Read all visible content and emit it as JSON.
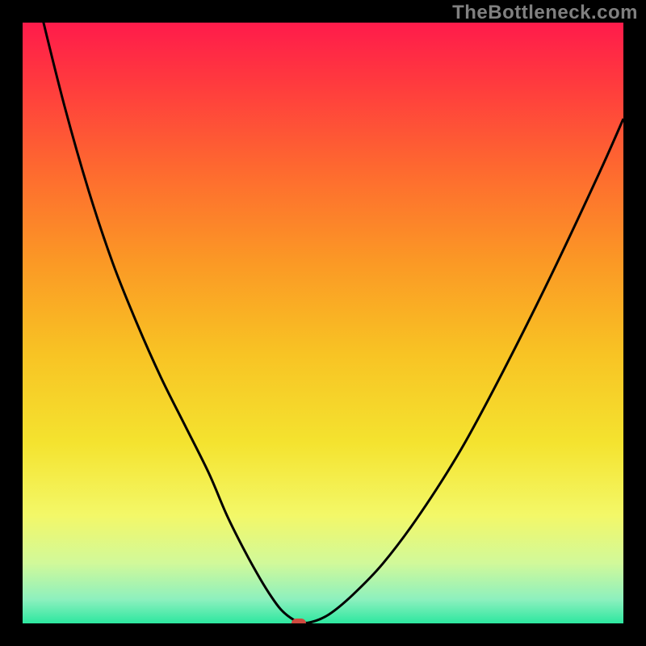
{
  "watermark": "TheBottleneck.com",
  "colors": {
    "frame": "#000000",
    "gradient_stops": [
      {
        "offset": 0.0,
        "color": "#ff1b4b"
      },
      {
        "offset": 0.1,
        "color": "#ff3a3e"
      },
      {
        "offset": 0.25,
        "color": "#fe6b2f"
      },
      {
        "offset": 0.4,
        "color": "#fb9925"
      },
      {
        "offset": 0.55,
        "color": "#f8c324"
      },
      {
        "offset": 0.7,
        "color": "#f4e32f"
      },
      {
        "offset": 0.82,
        "color": "#f3f868"
      },
      {
        "offset": 0.9,
        "color": "#d1f99a"
      },
      {
        "offset": 0.96,
        "color": "#8df0be"
      },
      {
        "offset": 1.0,
        "color": "#2de7a0"
      }
    ],
    "curve": "#000000",
    "marker": "#cf4a3f"
  },
  "chart_data": {
    "type": "line",
    "title": "",
    "xlabel": "",
    "ylabel": "",
    "xlim": [
      0,
      100
    ],
    "ylim": [
      0,
      100
    ],
    "grid": false,
    "annotations": [
      {
        "type": "marker",
        "x": 46,
        "y": 0,
        "shape": "rounded-rect",
        "color": "#cf4a3f"
      }
    ],
    "series": [
      {
        "name": "curve",
        "x": [
          0,
          3,
          7,
          11,
          15,
          19,
          23,
          27,
          31,
          34,
          37,
          39.5,
          41.5,
          43,
          44.5,
          46,
          48,
          51,
          55,
          60,
          66,
          73,
          80,
          88,
          96,
          100
        ],
        "y": [
          115,
          102,
          86,
          72,
          60,
          50,
          41,
          33,
          25,
          18,
          12,
          7.5,
          4.3,
          2.3,
          1.0,
          0.2,
          0.2,
          1.5,
          4.8,
          10,
          18,
          29,
          42,
          58,
          75,
          84
        ]
      }
    ]
  }
}
